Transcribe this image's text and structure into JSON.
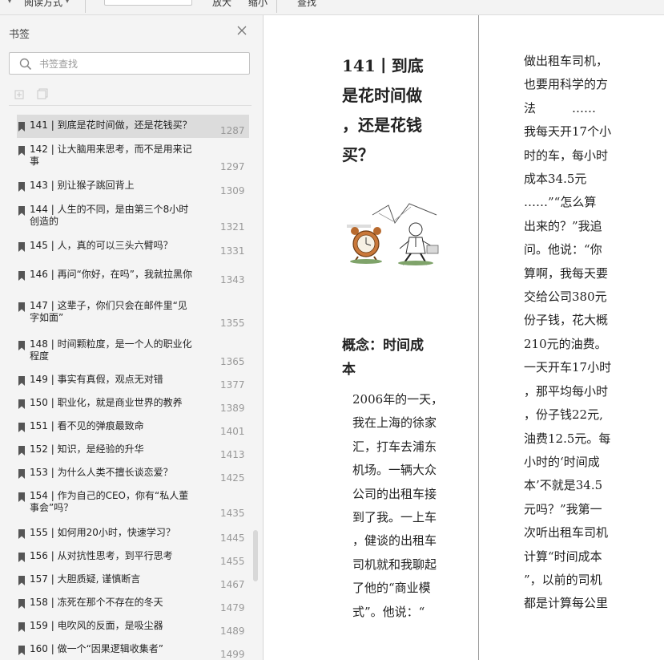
{
  "toolbar": {
    "view_mode": "阅读方式",
    "zoom_in": "放大",
    "zoom_out": "缩小",
    "find": "查找"
  },
  "sidebar": {
    "title": "书签",
    "search_placeholder": "书签查找",
    "bookmarks": [
      {
        "lines": [
          "141 | 到底是花时间做，还是花钱买？"
        ],
        "page": "1287",
        "selected": true
      },
      {
        "lines": [
          "142 | 让大脑用来思考，而不是用来记",
          "事"
        ],
        "page": "1297"
      },
      {
        "lines": [
          "143 | 别让猴子跳回背上"
        ],
        "page": "1309"
      },
      {
        "lines": [
          "144 | 人生的不同，是由第三个8小时",
          "创造的"
        ],
        "page": "1321"
      },
      {
        "lines": [
          "145 | 人，真的可以三头六臂吗？"
        ],
        "page": "1331"
      },
      {
        "lines": [
          "146 | 再问“你好，在吗”，我就拉黑你"
        ],
        "page": "1343"
      },
      {
        "lines": [
          "147 | 这辈子，你们只会在邮件里“见",
          "字如面”"
        ],
        "page": "1355"
      },
      {
        "lines": [
          "148 | 时间颗粒度，是一个人的职业化",
          "程度"
        ],
        "page": "1365"
      },
      {
        "lines": [
          "149 | 事实有真假，观点无对错"
        ],
        "page": "1377"
      },
      {
        "lines": [
          "150 | 职业化，就是商业世界的教养"
        ],
        "page": "1389"
      },
      {
        "lines": [
          "151 | 看不见的弹痕最致命"
        ],
        "page": "1401"
      },
      {
        "lines": [
          "152 | 知识，是经验的升华"
        ],
        "page": "1413"
      },
      {
        "lines": [
          "153 | 为什么人类不擅长谈恋爱？"
        ],
        "page": "1425"
      },
      {
        "lines": [
          "154 | 作为自己的CEO，你有“私人董",
          "事会”吗？"
        ],
        "page": "1435"
      },
      {
        "lines": [
          "155 | 如何用20小时，快速学习？"
        ],
        "page": "1445"
      },
      {
        "lines": [
          "156 | 从对抗性思考，到平行思考"
        ],
        "page": "1455"
      },
      {
        "lines": [
          "157 | 大胆质疑, 谨慎断言"
        ],
        "page": "1467"
      },
      {
        "lines": [
          "158 | 冻死在那个不存在的冬天"
        ],
        "page": "1479"
      },
      {
        "lines": [
          "159 | 电吹风的反面，是吸尘器"
        ],
        "page": "1489"
      },
      {
        "lines": [
          "160 | 做一个“因果逻辑收集者”"
        ],
        "page": "1499"
      }
    ]
  },
  "reader": {
    "heading_lines": [
      "141丨到底",
      "是花时间做",
      "，还是花钱",
      "买？"
    ],
    "subheading_lines": [
      "概念：时间成",
      "本"
    ],
    "col1_lines": [
      "2006年的一天，",
      "我在上海的徐家",
      "汇，打车去浦东",
      "机场。一辆大众",
      "公司的出租车接",
      "到了我。一上车",
      "，健谈的出租车",
      "司机就和我聊起",
      "了他的“商业模",
      "式”。他说：“"
    ],
    "col2_lines": [
      "做出租车司机，",
      "也要用科学的方",
      "法　　　……",
      "我每天开17个小",
      "时的车，每小时",
      "成本34.5元",
      "……”“怎么算",
      "出来的？”我追",
      "问。他说：“你",
      "算啊，我每天要",
      "交给公司380元",
      "份子钱，花大概",
      "210元的油费。",
      "一天开车17小时",
      "，那平均每小时",
      "，份子钱22元,",
      "油费12.5元。每",
      "小时的‘时间成",
      "本’不就是34.5",
      "元吗？”我第一",
      "次听出租车司机",
      "计算“时间成本",
      "”，以前的司机",
      "都是计算每公里"
    ]
  },
  "colors": {
    "toolbar_bg": "#f3f3f3",
    "sidebar_bg": "#f4f4f4",
    "selected_bg": "#dcdcdc",
    "page_number": "#999999"
  }
}
